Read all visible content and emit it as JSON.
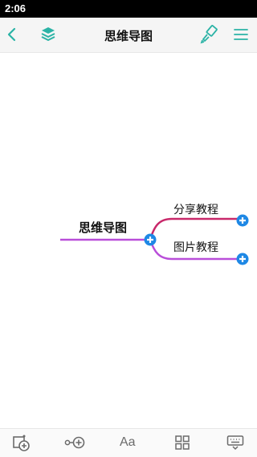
{
  "status_bar": {
    "time": "2:06"
  },
  "header": {
    "title": "思维导图",
    "icons": [
      "back-icon",
      "layers-icon",
      "paint-brush-icon",
      "menu-icon"
    ],
    "accent_color": "#2bb3a6"
  },
  "mindmap": {
    "root": {
      "label": "思维导图",
      "line_color": "#b94ed9"
    },
    "children": [
      {
        "label": "分享教程",
        "line_color": "#c8286a"
      },
      {
        "label": "图片教程",
        "line_color": "#b94ed9"
      }
    ],
    "toggle_color": "#1e88e5"
  },
  "toolbar": {
    "items": [
      "add-child-icon",
      "add-sibling-icon",
      "text-style-icon",
      "layout-grid-icon",
      "keyboard-icon"
    ],
    "text_style_label": "Aa"
  }
}
